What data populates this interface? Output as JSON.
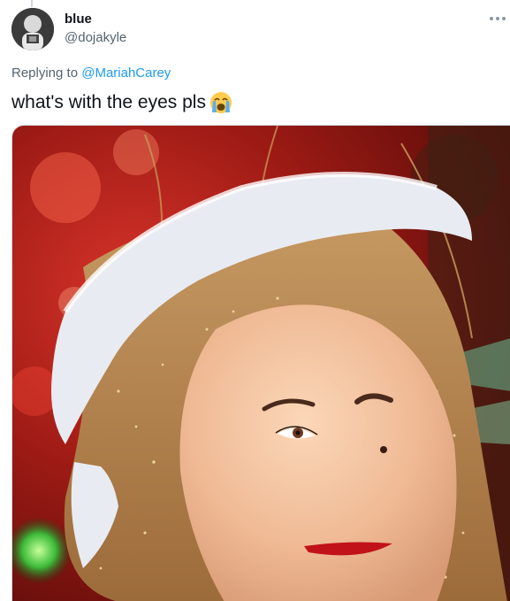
{
  "tweet": {
    "display_name": "blue",
    "handle": "@dojakyle",
    "replying_prefix": "Replying to",
    "replying_to": "@MariahCarey",
    "text": "what's with the eyes pls",
    "emoji": "loudly-crying-face-icon"
  },
  "colors": {
    "link": "#1d9bf0",
    "secondary_text": "#536471",
    "primary_text": "#0f1419"
  }
}
